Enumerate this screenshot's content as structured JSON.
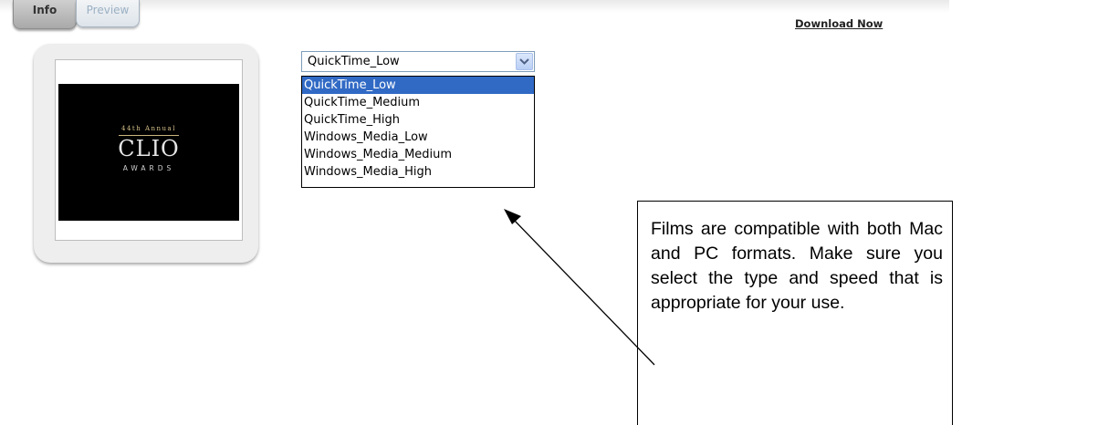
{
  "tabs": [
    {
      "label": "Info"
    },
    {
      "label": "Preview"
    }
  ],
  "download": {
    "label": "Download Now"
  },
  "thumbnail": {
    "line1": "44th Annual",
    "logo": "CLIO",
    "line3": "AWARDS"
  },
  "format_select": {
    "selected": "QuickTime_Low",
    "options": [
      "QuickTime_Low",
      "QuickTime_Medium",
      "QuickTime_High",
      "Windows_Media_Low",
      "Windows_Media_Medium",
      "Windows_Media_High"
    ]
  },
  "callout": {
    "text": "Films are compatible with both Mac and PC formats.  Make sure you select the type and speed that is appropriate for your use."
  },
  "colors": {
    "selection_highlight": "#316ac5",
    "select_border": "#7f9db9"
  }
}
